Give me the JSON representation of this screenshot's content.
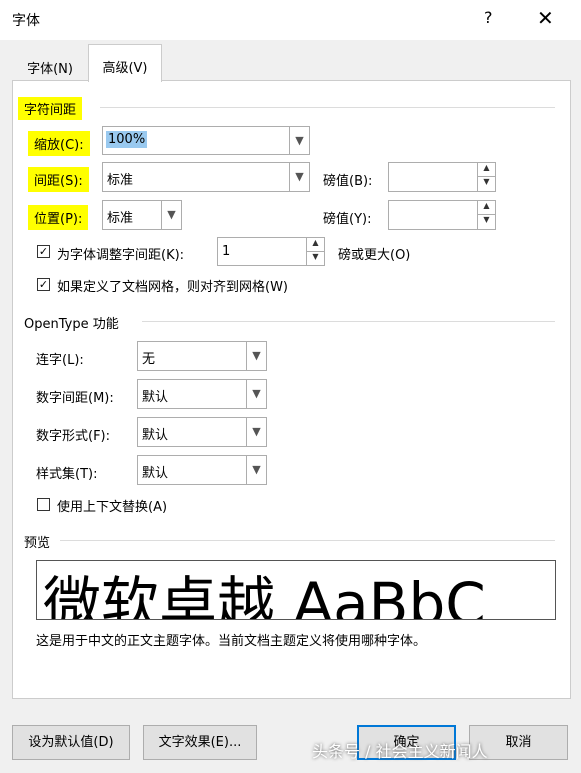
{
  "window": {
    "title": "字体",
    "help": "?",
    "close": "✕"
  },
  "tabs": [
    {
      "label": "字体(N)"
    },
    {
      "label": "高级(V)"
    }
  ],
  "char_spacing": {
    "section": "字符间距",
    "scale": {
      "label": "缩放(C):",
      "value": "100%"
    },
    "spacing": {
      "label": "间距(S):",
      "value": "标准",
      "by_label": "磅值(B):",
      "by_value": ""
    },
    "position": {
      "label": "位置(P):",
      "value": "标准",
      "by_label": "磅值(Y):",
      "by_value": ""
    },
    "kerning": {
      "label": "为字体调整字间距(K):",
      "checked": true,
      "value": "1",
      "suffix": "磅或更大(O)"
    },
    "snap_grid": {
      "label": "如果定义了文档网格，则对齐到网格(W)",
      "checked": true
    }
  },
  "opentype": {
    "section": "OpenType 功能",
    "ligatures": {
      "label": "连字(L):",
      "value": "无"
    },
    "num_spacing": {
      "label": "数字间距(M):",
      "value": "默认"
    },
    "num_forms": {
      "label": "数字形式(F):",
      "value": "默认"
    },
    "stylistic_sets": {
      "label": "样式集(T):",
      "value": "默认"
    },
    "contextual": {
      "label": "使用上下文替换(A)",
      "checked": false
    }
  },
  "preview": {
    "section": "预览",
    "sample": "微软卓越  AaBbC",
    "note": "这是用于中文的正文主题字体。当前文档主题定义将使用哪种字体。"
  },
  "buttons": {
    "set_default": "设为默认值(D)",
    "text_effects": "文字效果(E)...",
    "ok": "确定",
    "cancel": "取消"
  },
  "watermark": "头条号 / 社会主义新闻人",
  "colors": {
    "highlight": "#ffff00",
    "selection": "#99c9ef",
    "ok_border": "#0078d7"
  },
  "icons": {
    "dropdown": "chevron-down-icon",
    "spinner_up": "up-arrow-icon",
    "spinner_down": "down-arrow-icon",
    "check": "checkmark-icon"
  }
}
